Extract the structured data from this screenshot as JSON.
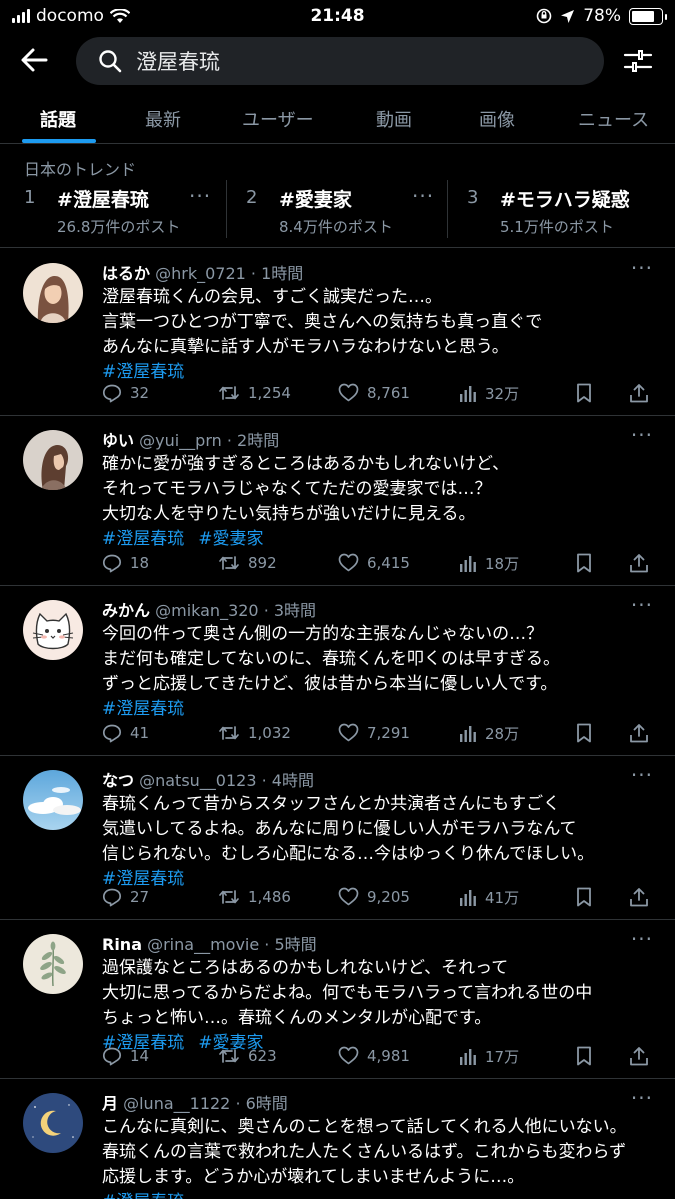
{
  "status_bar": {
    "carrier": "docomo",
    "time": "21:48",
    "battery": "78%",
    "battery_level": 0.78
  },
  "search": {
    "query": "澄屋春琉"
  },
  "tabs": [
    {
      "label": "話題",
      "active": true
    },
    {
      "label": "最新"
    },
    {
      "label": "ユーザー"
    },
    {
      "label": "動画"
    },
    {
      "label": "画像"
    },
    {
      "label": "ニュース"
    }
  ],
  "trends": {
    "heading": "日本のトレンド",
    "items": [
      {
        "rank": "1",
        "tag": "#澄屋春琉",
        "count": "26.8万件のポスト"
      },
      {
        "rank": "2",
        "tag": "#愛妻家",
        "count": "8.4万件のポスト"
      },
      {
        "rank": "3",
        "tag": "#モラハラ疑惑",
        "count": "5.1万件のポスト"
      }
    ]
  },
  "posts": [
    {
      "name": "はるか",
      "handle": "@hrk_0721",
      "time": "1時間",
      "lines": [
        "澄屋春琉くんの会見、すごく誠実だった…。",
        "言葉一つひとつが丁寧で、奥さんへの気持ちも真っ直ぐで",
        "あんなに真摯に話す人がモラハラなわけないと思う。"
      ],
      "hashtags": [
        "#澄屋春琉"
      ],
      "replies": "32",
      "reposts": "1,254",
      "likes": "8,761",
      "views": "32万",
      "avatar": "woman-portrait"
    },
    {
      "name": "ゆい",
      "handle": "@yui__prn",
      "time": "2時間",
      "lines": [
        "確かに愛が強すぎるところはあるかもしれないけど、",
        "それってモラハラじゃなくてただの愛妻家では…？",
        "大切な人を守りたい気持ちが強いだけに見える。"
      ],
      "hashtags": [
        "#澄屋春琉",
        "#愛妻家"
      ],
      "replies": "18",
      "reposts": "892",
      "likes": "6,415",
      "views": "18万",
      "avatar": "woman-profile"
    },
    {
      "name": "みかん",
      "handle": "@mikan_320",
      "time": "3時間",
      "lines": [
        "今回の件って奥さん側の一方的な主張なんじゃないの…？",
        "まだ何も確定してないのに、春琉くんを叩くのは早すぎる。",
        "ずっと応援してきたけど、彼は昔から本当に優しい人です。"
      ],
      "hashtags": [
        "#澄屋春琉"
      ],
      "replies": "41",
      "reposts": "1,032",
      "likes": "7,291",
      "views": "28万",
      "avatar": "cat-drawing"
    },
    {
      "name": "なつ",
      "handle": "@natsu__0123",
      "time": "4時間",
      "lines": [
        "春琉くんって昔からスタッフさんとか共演者さんにもすごく",
        "気遣いしてるよね。あんなに周りに優しい人がモラハラなんて",
        "信じられない。むしろ心配になる…今はゆっくり休んでほしい。"
      ],
      "hashtags": [
        "#澄屋春琉"
      ],
      "replies": "27",
      "reposts": "1,486",
      "likes": "9,205",
      "views": "41万",
      "avatar": "sky-clouds"
    },
    {
      "name": "Rina",
      "handle": "@rina__movie",
      "time": "5時間",
      "lines": [
        "過保護なところはあるのかもしれないけど、それって",
        "大切に思ってるからだよね。何でもモラハラって言われる世の中",
        "ちょっと怖い…。春琉くんのメンタルが心配です。"
      ],
      "hashtags": [
        "#澄屋春琉",
        "#愛妻家"
      ],
      "replies": "14",
      "reposts": "623",
      "likes": "4,981",
      "views": "17万",
      "avatar": "plant-sprig"
    },
    {
      "name": "月",
      "handle": "@luna__1122",
      "time": "6時間",
      "lines": [
        "こんなに真剣に、奥さんのことを想って話してくれる人他にいない。",
        "春琉くんの言葉で救われた人たくさんいるはず。これからも変わらず",
        "応援します。どうか心が壊れてしまいませんように…。"
      ],
      "hashtags": [
        "#澄屋春琉"
      ],
      "avatar": "crescent-moon"
    }
  ],
  "colors": {
    "accent": "#1d9bf0",
    "background": "#000000",
    "muted": "#8b98a5"
  }
}
